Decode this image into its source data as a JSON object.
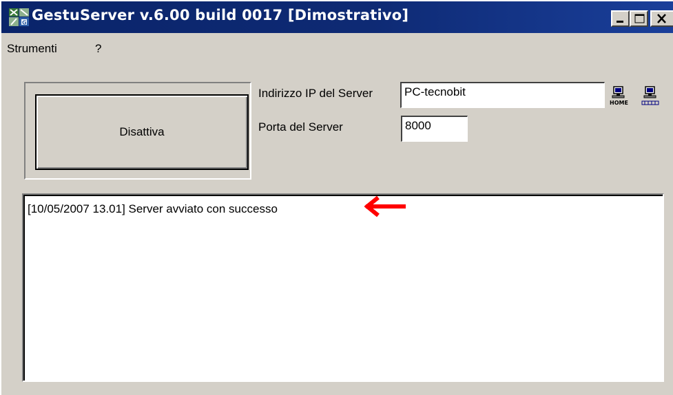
{
  "window": {
    "title": "GestuServer v.6.00 build 0017 [Dimostrativo]",
    "icon": "gestuserver-app-icon",
    "controls": [
      "minimize-icon",
      "maximize-icon",
      "close-icon"
    ]
  },
  "menu": {
    "items": [
      "Strumenti",
      "?"
    ]
  },
  "toggle_button": {
    "label": "Disattiva"
  },
  "server": {
    "ip_label": "Indirizzo IP del Server",
    "ip_value": "PC-tecnobit",
    "port_label": "Porta del Server",
    "port_value": "8000",
    "icon_buttons": [
      "home-computer-icon",
      "ip-address-computer-icon"
    ]
  },
  "log": {
    "lines": [
      "[10/05/2007 13.01] Server avviato con successo"
    ]
  },
  "annotation": {
    "icon": "red-arrow-icon",
    "color": "#ff0000"
  },
  "colors": {
    "titlebar": "#0a246a",
    "window_face": "#d4d0c8"
  }
}
